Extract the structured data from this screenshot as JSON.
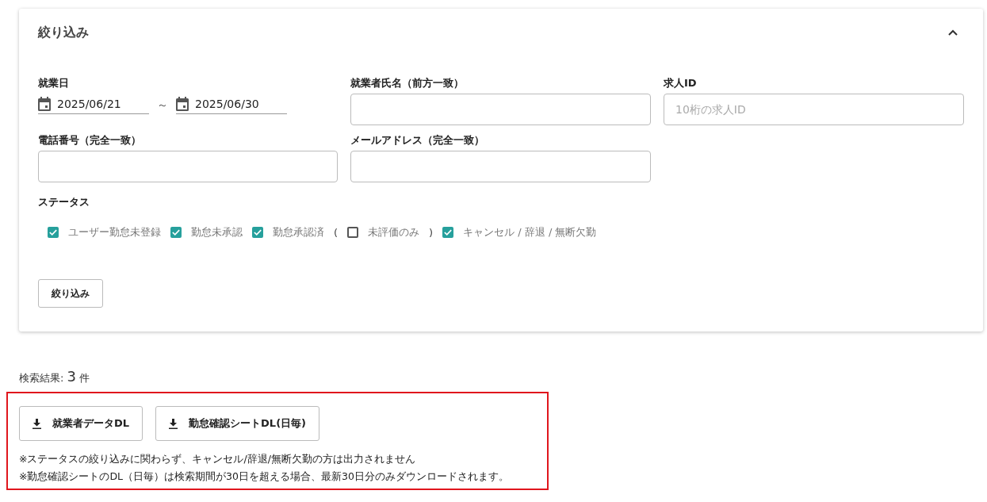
{
  "filter": {
    "title": "絞り込み",
    "expanded": true,
    "work_date": {
      "label": "就業日",
      "from": "2025/06/21",
      "separator": "～",
      "to": "2025/06/30"
    },
    "fields": [
      {
        "label": "就業者氏名（前方一致）"
      },
      {
        "label": "求人ID",
        "placeholder": "10桁の求人ID"
      },
      {
        "label": "電話番号（完全一致）"
      },
      {
        "label": "メールアドレス（完全一致）"
      }
    ],
    "status": {
      "label": "ステータス",
      "items": [
        {
          "kind": "checkbox",
          "label": "ユーザー勤怠未登録",
          "checked": true
        },
        {
          "kind": "checkbox",
          "label": "勤怠未承認",
          "checked": true
        },
        {
          "kind": "checkbox",
          "label": "勤怠承認済",
          "checked": true
        },
        {
          "kind": "text",
          "label": "("
        },
        {
          "kind": "checkbox",
          "label": "未評価のみ",
          "checked": false
        },
        {
          "kind": "text",
          "label": ")"
        },
        {
          "kind": "checkbox",
          "label": "キャンセル / 辞退 / 無断欠勤",
          "checked": true
        }
      ]
    },
    "submit": "絞り込み"
  },
  "results": {
    "label": "検索結果:",
    "count": "3",
    "unit": "件"
  },
  "downloads": {
    "buttons": [
      "就業者データDL",
      "勤怠確認シートDL(日毎)"
    ],
    "notes": [
      "※ステータスの絞り込みに関わらず、キャンセル/辞退/無断欠勤の方は出力されません",
      "※勤怠確認シートのDL（日毎）は検索期間が30日を超える場合、最新30日分のみダウンロードされます。"
    ]
  }
}
